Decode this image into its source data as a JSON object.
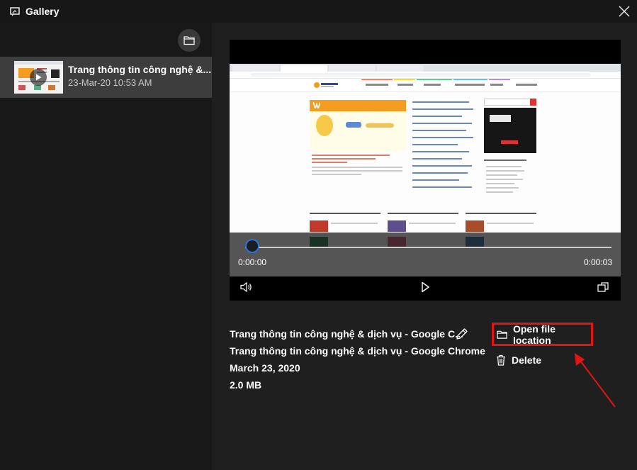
{
  "window": {
    "title": "Gallery",
    "icons": {
      "app": "gallery-icon",
      "close": "close-icon"
    }
  },
  "sidebar": {
    "folder_icon": "folder-icon",
    "items": [
      {
        "title": "Trang thông tin công nghệ &...",
        "datetime": "23-Mar-20 10:53 AM",
        "icon": "play-icon"
      }
    ]
  },
  "player": {
    "current_time": "0:00:00",
    "duration": "0:00:03",
    "progress": 0,
    "icons": {
      "volume": "volume-icon",
      "play": "play-icon",
      "picture_in_picture": "picture-in-picture-icon"
    }
  },
  "details": {
    "title_truncated": "Trang thông tin công nghệ & dịch vụ - Google C...",
    "title_full": "Trang thông tin công nghệ & dịch vụ - Google Chrome",
    "date": "March 23, 2020",
    "size": "2.0 MB",
    "edit_icon": "pencil-icon"
  },
  "actions": {
    "open_file_location": "Open file location",
    "delete": "Delete",
    "icons": {
      "open": "folder-icon",
      "delete": "trash-icon"
    }
  },
  "colors": {
    "background": "#1f1f1f",
    "sidebar": "#181818",
    "selected_item": "#3d3d3d",
    "seek_accent": "#2d74d6",
    "highlight": "#e31414"
  }
}
